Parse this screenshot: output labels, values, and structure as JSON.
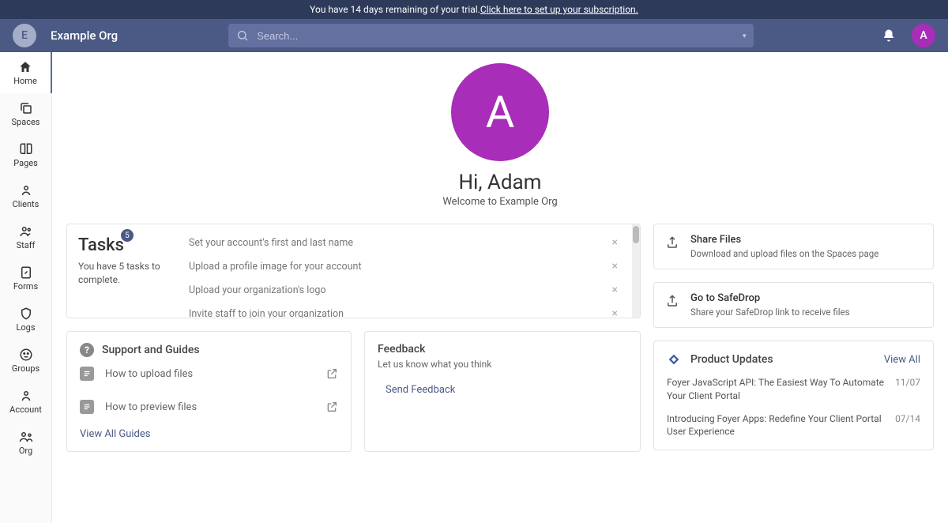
{
  "trial": {
    "text": "You have 14 days remaining of your trial. ",
    "link": "Click here to set up your subscription."
  },
  "header": {
    "org_initial": "E",
    "org_name": "Example Org",
    "search_placeholder": "Search...",
    "user_initial": "A"
  },
  "sidebar": {
    "items": [
      {
        "label": "Home"
      },
      {
        "label": "Spaces"
      },
      {
        "label": "Pages"
      },
      {
        "label": "Clients"
      },
      {
        "label": "Staff"
      },
      {
        "label": "Forms"
      },
      {
        "label": "Logs"
      },
      {
        "label": "Groups"
      },
      {
        "label": "Account"
      },
      {
        "label": "Org"
      }
    ]
  },
  "hero": {
    "avatar_initial": "A",
    "greeting": "Hi, Adam",
    "welcome": "Welcome to Example Org"
  },
  "tasks": {
    "title": "Tasks",
    "badge": "5",
    "subtitle": "You have 5 tasks to complete.",
    "items": [
      "Set your account's first and last name",
      "Upload a profile image for your account",
      "Upload your organization's logo",
      "Invite staff to join your organization"
    ]
  },
  "support": {
    "title": "Support and Guides",
    "guides": [
      {
        "label": "How to upload files"
      },
      {
        "label": "How to preview files"
      }
    ],
    "view_all": "View All Guides"
  },
  "feedback": {
    "title": "Feedback",
    "subtitle": "Let us know what you think",
    "button": "Send Feedback"
  },
  "actions": [
    {
      "title": "Share Files",
      "subtitle": "Download and upload files on the Spaces page"
    },
    {
      "title": "Go to SafeDrop",
      "subtitle": "Share your SafeDrop link to receive files"
    }
  ],
  "updates": {
    "title": "Product Updates",
    "view_all": "View All",
    "items": [
      {
        "title": "Foyer JavaScript API: The Easiest Way To Automate Your Client Portal",
        "date": "11/07"
      },
      {
        "title": "Introducing Foyer Apps: Redefine Your Client Portal User Experience",
        "date": "07/14"
      }
    ]
  }
}
